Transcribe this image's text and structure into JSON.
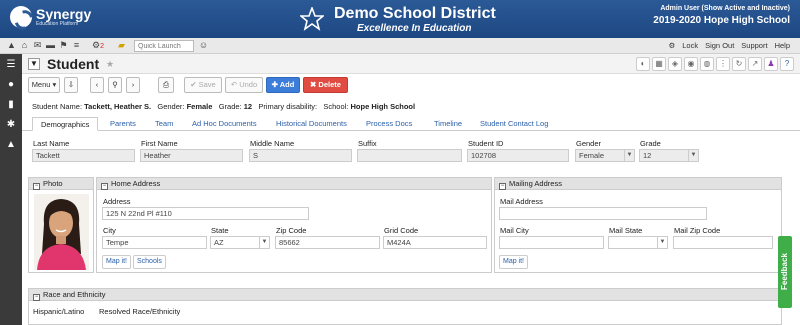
{
  "brand": {
    "name": "Synergy",
    "sub": "Education Platform"
  },
  "district": {
    "name": "Demo School District",
    "motto": "Excellence In Education"
  },
  "user": {
    "line": "Admin User (Show Active and Inactive)",
    "school_year": "2019-2020 Hope High School"
  },
  "toolbar": {
    "quick_launch_placeholder": "Quick Launch",
    "badge_count": "2",
    "links": [
      "Lock",
      "Sign Out",
      "Support",
      "Help"
    ]
  },
  "title": {
    "text": "Student"
  },
  "actions": {
    "menu": "Menu",
    "save": "Save",
    "undo": "Undo",
    "add": "Add",
    "delete": "Delete"
  },
  "student": {
    "name_label": "Student Name:",
    "name": "Tackett, Heather S.",
    "gender_label": "Gender:",
    "gender": "Female",
    "grade_label": "Grade:",
    "grade": "12",
    "disability_label": "Primary disability:",
    "school_label": "School:",
    "school": "Hope High School"
  },
  "tabs": [
    "Demographics",
    "Parents",
    "Team",
    "Ad Hoc Documents",
    "Historical Documents",
    "Process Docs",
    "Timeline",
    "Student Contact Log"
  ],
  "fields": {
    "last_name": {
      "label": "Last Name",
      "value": "Tackett"
    },
    "first_name": {
      "label": "First Name",
      "value": "Heather"
    },
    "middle_name": {
      "label": "Middle Name",
      "value": "S"
    },
    "suffix": {
      "label": "Suffix",
      "value": ""
    },
    "student_id": {
      "label": "Student ID",
      "value": "102708"
    },
    "gender": {
      "label": "Gender",
      "value": "Female"
    },
    "grade": {
      "label": "Grade",
      "value": "12"
    }
  },
  "photo_panel": {
    "title": "Photo"
  },
  "home_address": {
    "title": "Home Address",
    "address_label": "Address",
    "address": "125 N 22nd Pl #110",
    "city_label": "City",
    "city": "Tempe",
    "state_label": "State",
    "state": "AZ",
    "zip_label": "Zip Code",
    "zip": "85662",
    "grid_label": "Grid Code",
    "grid": "M424A",
    "map_btn": "Map it!",
    "schools_btn": "Schools"
  },
  "mailing_address": {
    "title": "Mailing Address",
    "address_label": "Mail Address",
    "address": "",
    "city_label": "Mail City",
    "city": "",
    "state_label": "Mail State",
    "state": "",
    "zip_label": "Mail Zip Code",
    "zip": "",
    "map_btn": "Map it!"
  },
  "race_panel": {
    "title": "Race and Ethnicity",
    "col1": "Hispanic/Latino",
    "col2": "Resolved Race/Ethnicity"
  },
  "feedback": {
    "label": "Feedback"
  }
}
